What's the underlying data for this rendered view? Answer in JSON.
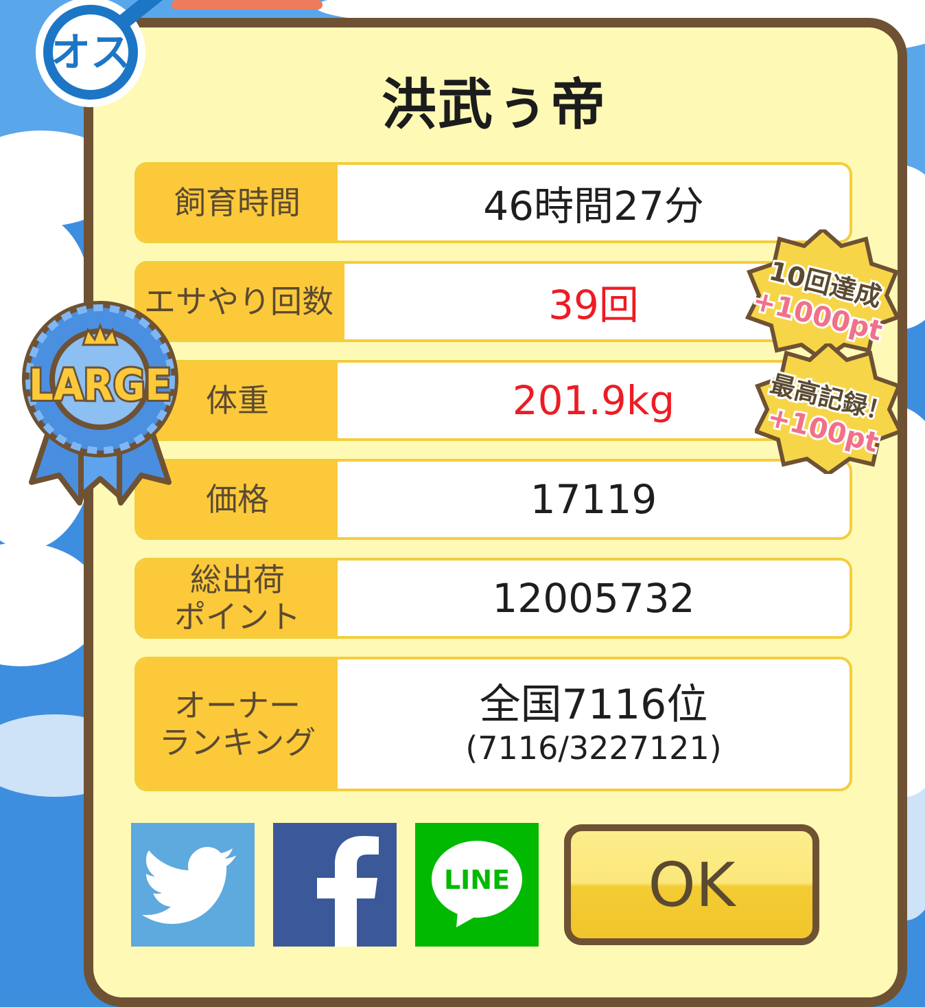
{
  "pet_name": "洪武ぅ帝",
  "gender_badge": {
    "text": "オス",
    "icon": "male-symbol-icon"
  },
  "rank_ribbon": {
    "text": "LARGE",
    "icon": "crown-icon"
  },
  "stats": [
    {
      "label": "飼育時間",
      "value": "46時間27分"
    },
    {
      "label": "エサやり回数",
      "value": "39回",
      "highlight": true
    },
    {
      "label": "体重",
      "value": "201.9kg",
      "highlight": true
    },
    {
      "label": "価格",
      "value": "17119"
    },
    {
      "label": "総出荷\nポイント",
      "value": "12005732"
    },
    {
      "label": "オーナー\nランキング",
      "value": "全国7116位",
      "sub_value": "(7116/3227121)"
    }
  ],
  "achievements": [
    {
      "title": "10回達成",
      "bonus": "+1000pt"
    },
    {
      "title": "最高記録！",
      "bonus": "+100pt"
    }
  ],
  "share": {
    "twitter": {
      "icon": "twitter-bird-icon",
      "color": "#5ea9dd"
    },
    "facebook": {
      "icon": "facebook-f-icon",
      "color": "#3b5998"
    },
    "line": {
      "label": "LINE",
      "icon": "line-bubble-icon",
      "color": "#00b900"
    }
  },
  "ok_label": "OK",
  "colors": {
    "label_bg": "#fbc93a",
    "panel_bg": "#fefab6",
    "frame": "#6e5233",
    "highlight": "#ed1c24"
  }
}
